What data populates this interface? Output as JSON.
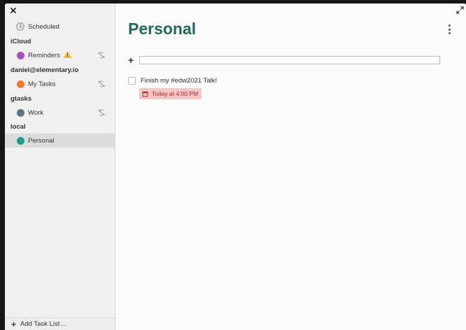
{
  "sidebar": {
    "scheduled_label": "Scheduled",
    "sources": [
      {
        "header": "iCloud",
        "lists": [
          {
            "label": "Reminders",
            "color": "#a64fc0",
            "warning": true
          }
        ]
      },
      {
        "header": "daniel@elementary.io",
        "lists": [
          {
            "label": "My Tasks",
            "color": "#f07c32"
          }
        ]
      },
      {
        "header": "gtasks",
        "lists": [
          {
            "label": "Work",
            "color": "#5f7485"
          }
        ]
      },
      {
        "header": "local",
        "lists": [
          {
            "label": "Personal",
            "color": "#1d9a8a",
            "selected": true
          }
        ]
      }
    ],
    "add_list_label": "Add Task List…"
  },
  "main": {
    "title": "Personal",
    "title_color": "#1f6b5f",
    "new_task_placeholder": "",
    "tasks": [
      {
        "title": "Finish my #edw2021 Talk!",
        "due": "Today at 4:00 PM",
        "completed": false
      }
    ]
  },
  "colors": {
    "due_bg": "#f6c6c4",
    "due_text": "#b0282f",
    "selected_bg": "#dcdcdc"
  }
}
